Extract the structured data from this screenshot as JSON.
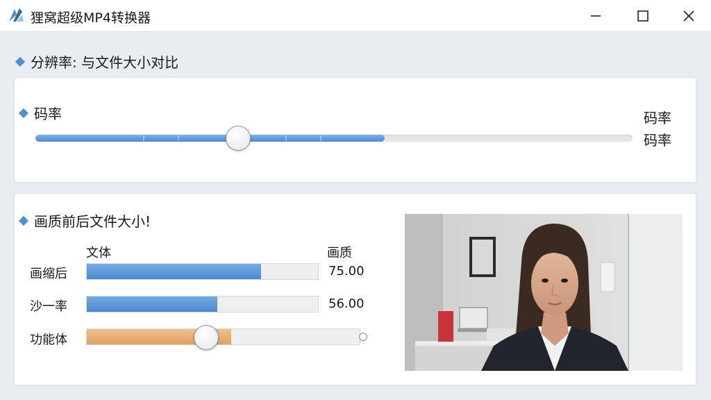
{
  "window": {
    "title": "狸窝超级MP4转换器",
    "controls": {
      "minimize": "minimize-icon",
      "maximize": "maximize-icon",
      "close": "close-icon"
    }
  },
  "section_main": {
    "heading": "分辨率: 与文件大小对比"
  },
  "bitrate_panel": {
    "heading": "码率",
    "right_labels": [
      "码率",
      "码率"
    ],
    "slider_level": 0.58,
    "fill_level": 0.585
  },
  "quality_panel": {
    "heading": "画质前后文件大小!",
    "col_left": "文体",
    "col_right": "画质",
    "rows": [
      {
        "label": "画缩后",
        "value": "75.00",
        "level": 0.75,
        "color": "#4d8ad0"
      },
      {
        "label": "沙一率",
        "value": "56.00",
        "level": 0.56,
        "color": "#4d8ad0"
      },
      {
        "label": "功能体",
        "value": "",
        "level": 0.52,
        "color": "#dea066"
      }
    ]
  },
  "colors": {
    "accent": "#4f8fd0",
    "slider_blue": "#4b8bd2",
    "slider_orange": "#dea066"
  }
}
